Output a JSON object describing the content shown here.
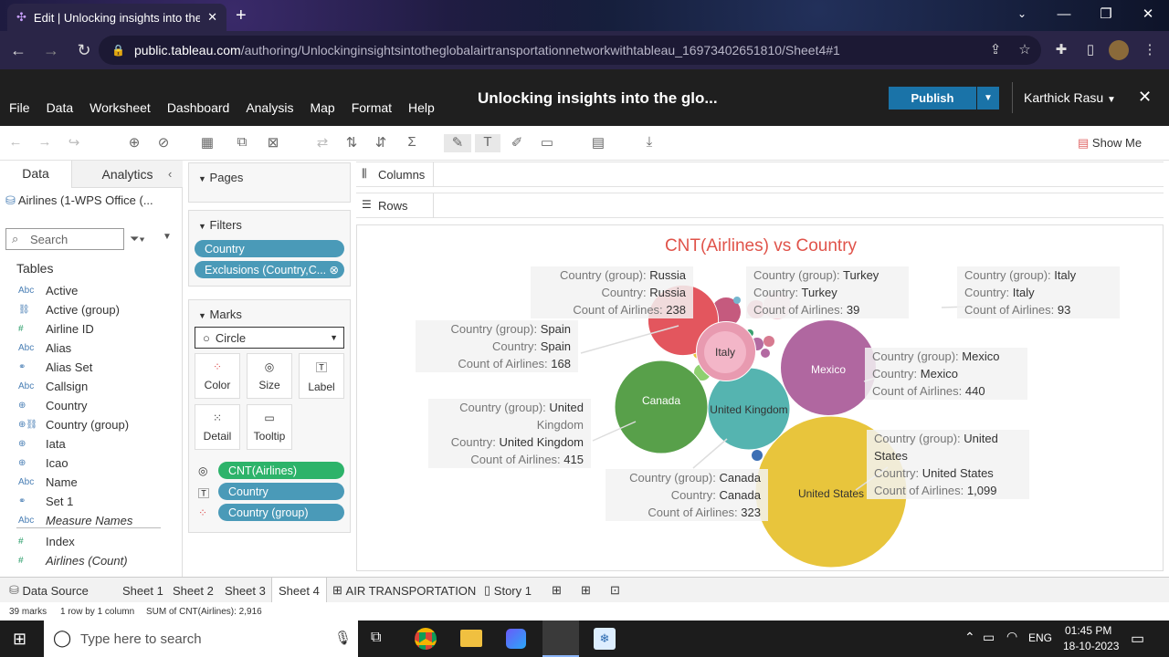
{
  "browser": {
    "tab_title": "Edit | Unlocking insights into the",
    "url_host": "public.tableau.com",
    "url_path": "/authoring/Unlockinginsightsintotheglobalairtransportationnetworkwithtableau_16973402651810/Sheet4#1"
  },
  "app": {
    "menu": [
      "File",
      "Data",
      "Worksheet",
      "Dashboard",
      "Analysis",
      "Map",
      "Format",
      "Help"
    ],
    "workbook_title": "Unlocking insights into the glo...",
    "publish_label": "Publish",
    "user_name": "Karthick Rasu",
    "show_me": "Show Me"
  },
  "data_pane": {
    "tab_data": "Data",
    "tab_analytics": "Analytics",
    "datasource": "Airlines (1-WPS Office (...",
    "search_placeholder": "Search",
    "tables_label": "Tables",
    "fields": [
      {
        "type": "Abc",
        "name": "Active"
      },
      {
        "type": "link",
        "name": "Active (group)"
      },
      {
        "type": "#",
        "name": "Airline ID"
      },
      {
        "type": "Abc",
        "name": "Alias"
      },
      {
        "type": "set",
        "name": "Alias Set"
      },
      {
        "type": "Abc",
        "name": "Callsign"
      },
      {
        "type": "globe",
        "name": "Country"
      },
      {
        "type": "globe-link",
        "name": "Country (group)"
      },
      {
        "type": "globe",
        "name": "Iata"
      },
      {
        "type": "globe",
        "name": "Icao"
      },
      {
        "type": "Abc",
        "name": "Name"
      },
      {
        "type": "set",
        "name": "Set 1"
      },
      {
        "type": "Abc",
        "name": "Measure Names"
      },
      {
        "type": "#",
        "name": "Index"
      },
      {
        "type": "#",
        "name": "Airlines (Count)"
      }
    ]
  },
  "cards": {
    "pages_label": "Pages",
    "filters_label": "Filters",
    "filters": [
      "Country",
      "Exclusions (Country,C..."
    ],
    "marks_label": "Marks",
    "mark_type": "Circle",
    "mark_buttons": [
      "Color",
      "Size",
      "Label",
      "Detail",
      "Tooltip"
    ],
    "mark_pills": [
      "CNT(Airlines)",
      "Country",
      "Country (group)"
    ]
  },
  "shelves": {
    "columns": "Columns",
    "rows": "Rows"
  },
  "viz": {
    "title": "CNT(Airlines) vs Country",
    "bubble_labels": [
      "United States",
      "Mexico",
      "Canada",
      "United Kingdom",
      "Italy"
    ],
    "tooltips": [
      {
        "group_label": "Country (group):",
        "group": "Russia",
        "country_label": "Country:",
        "country": "Russia",
        "count_label": "Count of Airlines:",
        "count": "238"
      },
      {
        "group_label": "Country (group):",
        "group": "Turkey",
        "country_label": "Country:",
        "country": "Turkey",
        "count_label": "Count of Airlines:",
        "count": "39"
      },
      {
        "group_label": "Country (group):",
        "group": "Italy",
        "country_label": "Country:",
        "country": "Italy",
        "count_label": "Count of Airlines:",
        "count": "93"
      },
      {
        "group_label": "Country (group):",
        "group": "Spain",
        "country_label": "Country:",
        "country": "Spain",
        "count_label": "Count of Airlines:",
        "count": "168"
      },
      {
        "group_label": "Country (group):",
        "group": "Mexico",
        "country_label": "Country:",
        "country": "Mexico",
        "count_label": "Count of Airlines:",
        "count": "440"
      },
      {
        "group_label": "Country (group):",
        "group": "United",
        "group2": "Kingdom",
        "country_label": "Country:",
        "country": "United Kingdom",
        "count_label": "Count of Airlines:",
        "count": "415"
      },
      {
        "group_label": "Country (group):",
        "group": "United",
        "group2": "States",
        "country_label": "Country:",
        "country": "United States",
        "count_label": "Count of Airlines:",
        "count": "1,099"
      },
      {
        "group_label": "Country (group):",
        "group": "Canada",
        "country_label": "Country:",
        "country": "Canada",
        "count_label": "Count of Airlines:",
        "count": "323"
      }
    ]
  },
  "chart_data": {
    "type": "scatter",
    "title": "CNT(Airlines) vs Country",
    "categories": [
      "United States",
      "Mexico",
      "United Kingdom",
      "Canada",
      "Russia",
      "Spain",
      "Italy",
      "Turkey"
    ],
    "values": [
      1099,
      440,
      415,
      323,
      238,
      168,
      93,
      39
    ],
    "colors": [
      "#e8c53c",
      "#b067a0",
      "#58a04a",
      "#55b4b0",
      "#e3565e",
      "#e89ab0",
      "#f3b6c8",
      "#f5d2d8"
    ]
  },
  "sheet_tabs": {
    "data_source": "Data Source",
    "tabs": [
      "Sheet 1",
      "Sheet 2",
      "Sheet 3",
      "Sheet 4",
      "AIR TRANSPORTATION",
      "Story 1"
    ]
  },
  "status": {
    "marks": "39 marks",
    "dims": "1 row by 1 column",
    "sum": "SUM of CNT(Airlines): 2,916"
  },
  "taskbar": {
    "search_placeholder": "Type here to search",
    "lang": "ENG",
    "time": "01:45 PM",
    "date": "18-10-2023"
  }
}
